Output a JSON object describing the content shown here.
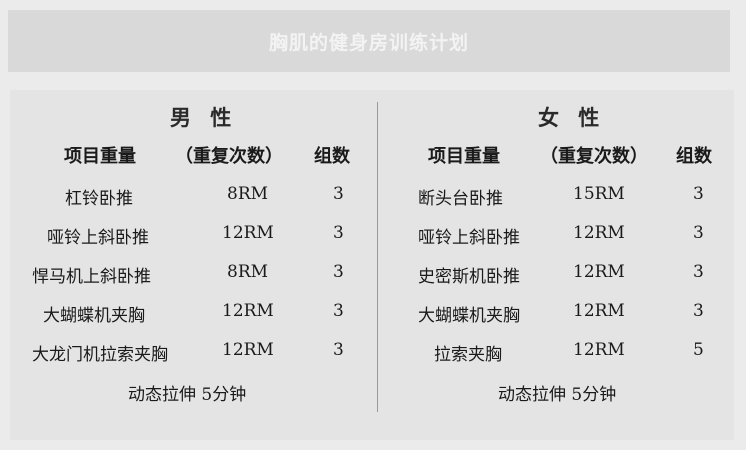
{
  "title": "胸肌的健身房训练计划",
  "male": {
    "heading": "男 性",
    "columns": {
      "item": "项目重量",
      "reps": "（重复次数）",
      "sets": "组数"
    },
    "rows": [
      {
        "name": "杠铃卧推",
        "reps": "8RM",
        "sets": "3"
      },
      {
        "name": "哑铃上斜卧推",
        "reps": "12RM",
        "sets": "3"
      },
      {
        "name": "悍马机上斜卧推",
        "reps": "8RM",
        "sets": "3"
      },
      {
        "name": "大蝴蝶机夹胸",
        "reps": "12RM",
        "sets": "3"
      },
      {
        "name": "大龙门机拉索夹胸",
        "reps": "12RM",
        "sets": "3"
      }
    ],
    "footer": "动态拉伸 5分钟"
  },
  "female": {
    "heading": "女 性",
    "columns": {
      "item": "项目重量",
      "reps": "（重复次数）",
      "sets": "组数"
    },
    "rows": [
      {
        "name": "断头台卧推",
        "reps": "15RM",
        "sets": "3"
      },
      {
        "name": "哑铃上斜卧推",
        "reps": "12RM",
        "sets": "3"
      },
      {
        "name": "史密斯机卧推",
        "reps": "12RM",
        "sets": "3"
      },
      {
        "name": "大蝴蝶机夹胸",
        "reps": "12RM",
        "sets": "3"
      },
      {
        "name": "拉索夹胸",
        "reps": "12RM",
        "sets": "5"
      }
    ],
    "footer": "动态拉伸 5分钟"
  }
}
